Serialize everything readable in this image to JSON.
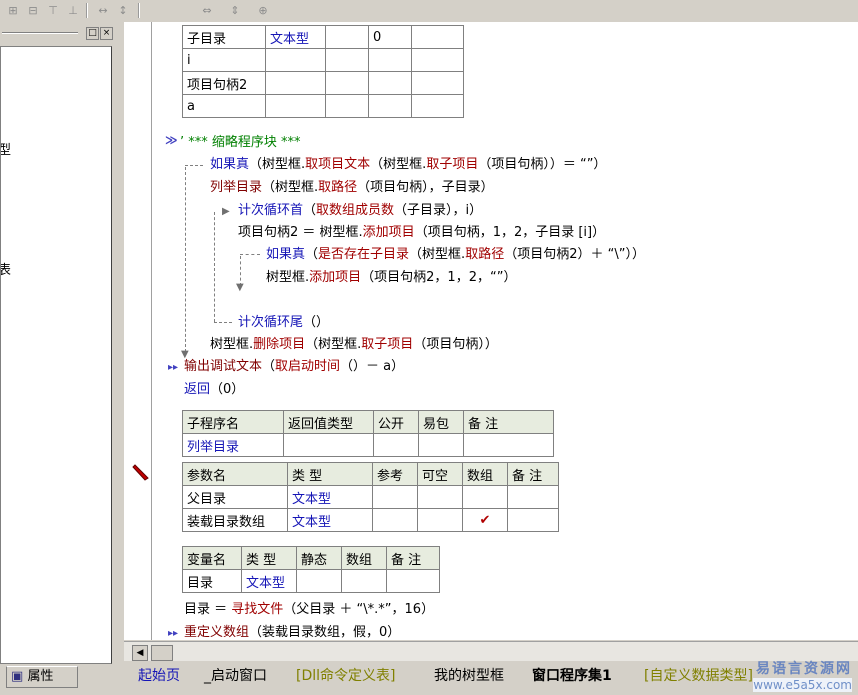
{
  "tables_top": {
    "rows": [
      [
        "子目录",
        "文本型",
        "",
        "0",
        ""
      ],
      [
        "i",
        "",
        "",
        "",
        ""
      ],
      [
        "项目句柄2",
        "",
        "",
        "",
        ""
      ],
      [
        "a",
        "",
        "",
        "",
        ""
      ]
    ]
  },
  "code": {
    "comment": "’ *** 缩略程序块 ***",
    "l_if": "如果真",
    "l_if_rest1": "（树型框.",
    "l_if_fn1": "取项目文本",
    "l_if_rest2": "（树型框.",
    "l_if_fn2": "取子项目",
    "l_if_rest3": "（项目句柄））＝ “”）",
    "l_enum": "列举目录",
    "l_enum_rest1": "（树型框.",
    "l_enum_fn": "取路径",
    "l_enum_rest2": "（项目句柄），子目录）",
    "l_loop": "计次循环首",
    "l_loop_rest1": "（",
    "l_loop_fn": "取数组成员数",
    "l_loop_rest2": "（子目录），i）",
    "l_assign": "项目句柄2 ＝ 树型框.",
    "l_assign_fn": "添加项目",
    "l_assign_rest": "（项目句柄，1，2，子目录 [i]）",
    "l_if2": "如果真",
    "l_if2_rest1": "（",
    "l_if2_fn1": "是否存在子目录",
    "l_if2_rest2": "（树型框.",
    "l_if2_fn2": "取路径",
    "l_if2_rest3": "（项目句柄2）＋ “\\”））",
    "l_add": "树型框.",
    "l_add_fn": "添加项目",
    "l_add_rest": "（项目句柄2，1，2，“”）",
    "l_loopend": "计次循环尾",
    "l_loopend_rest": "（）",
    "l_del": "树型框.",
    "l_del_fn": "删除项目",
    "l_del_rest1": "（树型框.",
    "l_del_fn2": "取子项目",
    "l_del_rest2": "（项目句柄））",
    "l_dbg": "输出调试文本",
    "l_dbg_rest1": "（",
    "l_dbg_fn": "取启动时间",
    "l_dbg_rest2": "（）－ a）",
    "l_ret": "返回",
    "l_ret_rest": "（0）",
    "l_find": "目录 ＝ ",
    "l_find_fn": "寻找文件",
    "l_find_rest": "（父目录 ＋ “\\*.*”，16）",
    "l_redim": "重定义数组",
    "l_redim_rest": "（装载目录数组，假，0）"
  },
  "sub_table": {
    "headers": [
      "子程序名",
      "返回值类型",
      "公开",
      "易包",
      "备 注"
    ],
    "name": "列举目录"
  },
  "param_table": {
    "headers": [
      "参数名",
      "类 型",
      "参考",
      "可空",
      "数组",
      "备 注"
    ],
    "rows": [
      [
        "父目录",
        "文本型",
        "",
        "",
        "",
        ""
      ],
      [
        "装载目录数组",
        "文本型",
        "",
        "",
        "✔",
        ""
      ]
    ]
  },
  "var_table": {
    "headers": [
      "变量名",
      "类 型",
      "静态",
      "数组",
      "备 注"
    ],
    "rows": [
      [
        "目录",
        "文本型",
        "",
        "",
        ""
      ]
    ]
  },
  "left_panel": {
    "frag1": "型",
    "frag2": "表",
    "properties_tab": "属性"
  },
  "tabs": [
    {
      "label": "起始页"
    },
    {
      "label": "_启动窗口"
    },
    {
      "label": "[Dll命令定义表]"
    },
    {
      "label": "我的树型框"
    },
    {
      "label": "窗口程序集1"
    },
    {
      "label": "[自定义数据类型]"
    }
  ],
  "watermark": {
    "line1": "易语言资源网",
    "line2": "www.e5a5x.com"
  },
  "colors": {
    "accent_blue": "#1515b6",
    "keyword_red": "#a00000",
    "comment_green": "#008000"
  }
}
